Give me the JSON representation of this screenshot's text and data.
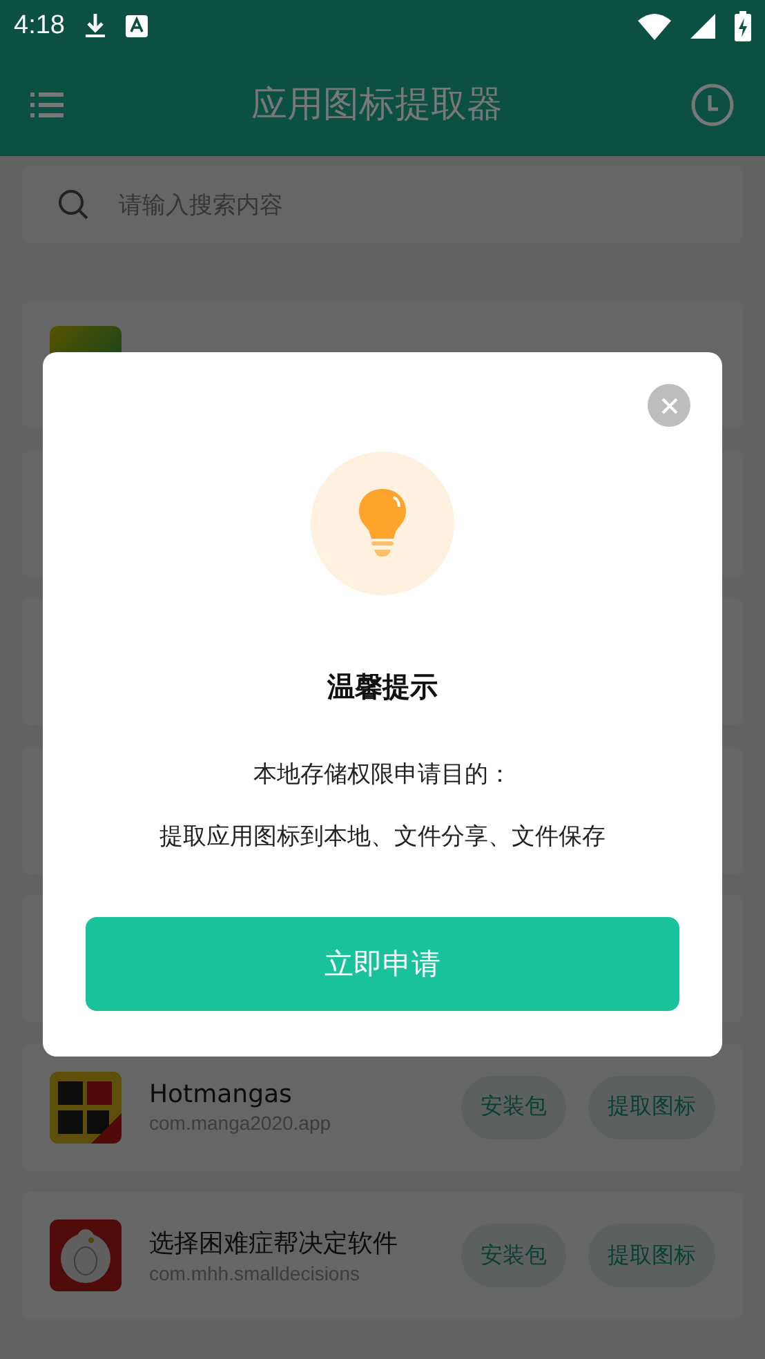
{
  "status_bar": {
    "time": "4:18"
  },
  "app_bar": {
    "title": "应用图标提取器"
  },
  "search": {
    "placeholder": "请输入搜索内容"
  },
  "apps": [
    {
      "kind": "partial"
    },
    {
      "kind": "hidden"
    },
    {
      "kind": "hidden"
    },
    {
      "kind": "hidden"
    },
    {
      "kind": "hidden"
    },
    {
      "kind": "full",
      "name": "Hotmangas",
      "package": "com.manga2020.app",
      "buttons": [
        "安装包",
        "提取图标"
      ]
    },
    {
      "kind": "full",
      "name": "选择困难症帮决定软件",
      "package": "com.mhh.smalldecisions",
      "buttons": [
        "安装包",
        "提取图标"
      ]
    }
  ],
  "dialog": {
    "title": "温馨提示",
    "lines": [
      "本地存储权限申请目的：",
      "提取应用图标到本地、文件分享、文件保存"
    ],
    "button": "立即申请"
  }
}
